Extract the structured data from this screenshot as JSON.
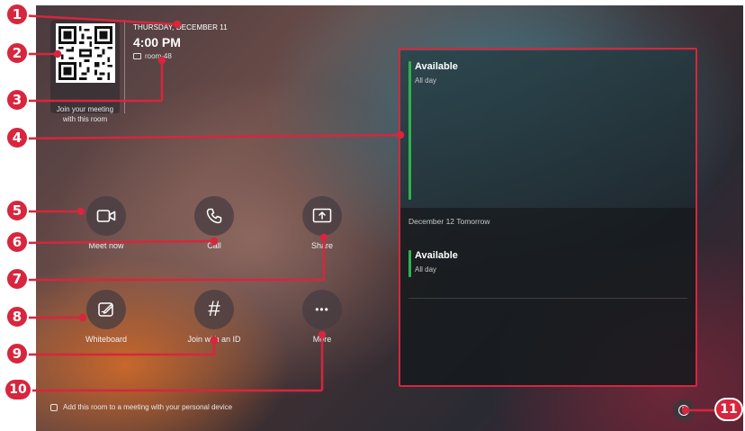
{
  "header": {
    "date": "THURSDAY, DECEMBER 11",
    "time": "4:00 PM",
    "room_name": "room-48",
    "qr_caption": "Join your meeting with this room"
  },
  "actions": [
    {
      "label": "Meet now",
      "icon": "video-camera-icon"
    },
    {
      "label": "Call",
      "icon": "phone-icon"
    },
    {
      "label": "Share",
      "icon": "share-screen-icon"
    },
    {
      "label": "Whiteboard",
      "icon": "whiteboard-icon"
    },
    {
      "label": "Join with an ID",
      "icon": "hash-icon",
      "glyph": "#"
    },
    {
      "label": "More",
      "icon": "more-icon",
      "glyph": "•••"
    }
  ],
  "agenda": {
    "today": {
      "title": "Available",
      "sub": "All day"
    },
    "day_heading": "December 12 Tomorrow",
    "tomorrow": {
      "title": "Available",
      "sub": "All day"
    }
  },
  "footer": {
    "hint": "Add this room to a meeting with your personal device",
    "help_icon": "help-icon",
    "help_glyph": "?"
  },
  "callouts": [
    "1",
    "2",
    "3",
    "4",
    "5",
    "6",
    "7",
    "8",
    "9",
    "10",
    "11"
  ],
  "colors": {
    "callout_red": "#d7263d",
    "available_green": "#2fb34b"
  }
}
